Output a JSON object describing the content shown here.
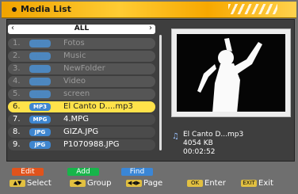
{
  "header": {
    "title": "Media List"
  },
  "filter": {
    "left_arrow": "‹",
    "label": "ALL",
    "right_arrow": "›"
  },
  "files": [
    {
      "num": "1.",
      "type": "Dir",
      "name": "Fotos",
      "state": "dim"
    },
    {
      "num": "2.",
      "type": "Dir",
      "name": "Music",
      "state": "dim"
    },
    {
      "num": "3.",
      "type": "Dir",
      "name": "NewFolder",
      "state": "dim"
    },
    {
      "num": "4.",
      "type": "Dir",
      "name": "Video",
      "state": "dim"
    },
    {
      "num": "5.",
      "type": "Dir",
      "name": "screen",
      "state": "dim"
    },
    {
      "num": "6.",
      "type": "MP3",
      "name": "El Canto D....mp3",
      "state": "selected"
    },
    {
      "num": "7.",
      "type": "MPG",
      "name": "4.MPG",
      "state": "normal"
    },
    {
      "num": "8.",
      "type": "JPG",
      "name": "GIZA.JPG",
      "state": "normal"
    },
    {
      "num": "9.",
      "type": "JPG",
      "name": "P1070988.JPG",
      "state": "normal"
    }
  ],
  "info": {
    "name": "El Canto D...mp3",
    "size": "4054  KB",
    "duration": "00:02:52"
  },
  "buttons": [
    {
      "label": "Edit",
      "color": "#e0531c"
    },
    {
      "label": "Add",
      "color": "#17b54a"
    },
    {
      "label": "Find",
      "color": "#3a86d6"
    }
  ],
  "footer": {
    "select_label": "Select",
    "group_label": "Group",
    "page_label": "Page",
    "enter_label": "Enter",
    "exit_label": "Exit"
  }
}
